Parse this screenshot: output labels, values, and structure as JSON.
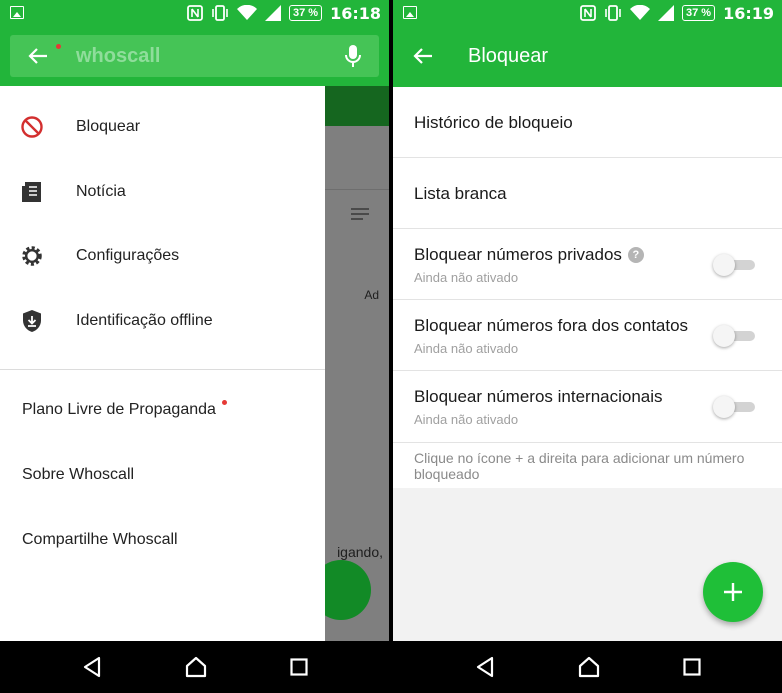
{
  "status_left": {
    "battery": "37 %",
    "time": "16:18"
  },
  "status_right": {
    "battery": "37 %",
    "time": "16:19"
  },
  "search": {
    "placeholder": "whoscall"
  },
  "drawer": {
    "icon_items": [
      {
        "label": "Bloquear",
        "icon": "block-icon"
      },
      {
        "label": "Notícia",
        "icon": "news-icon"
      },
      {
        "label": "Configurações",
        "icon": "gear-icon"
      },
      {
        "label": "Identificação offline",
        "icon": "shield-download-icon"
      }
    ],
    "text_items": [
      {
        "label": "Plano Livre de Propaganda",
        "badge": true
      },
      {
        "label": "Sobre Whoscall",
        "badge": false
      },
      {
        "label": "Compartilhe Whoscall",
        "badge": false
      }
    ]
  },
  "background": {
    "ad_label": "Ad",
    "partial_text": "igando,"
  },
  "block_screen": {
    "title": "Bloquear",
    "history": "Histórico de bloqueio",
    "whitelist": "Lista branca",
    "toggles": [
      {
        "label": "Bloquear números privados",
        "status": "Ainda não ativado",
        "on": false,
        "help": true
      },
      {
        "label": "Bloquear números fora dos contatos",
        "status": "Ainda não ativado",
        "on": false,
        "help": false
      },
      {
        "label": "Bloquear números internacionais",
        "status": "Ainda não ativado",
        "on": false,
        "help": false
      }
    ],
    "hint": "Clique no ícone + a direita para adicionar um número bloqueado",
    "help_glyph": "?"
  },
  "colors": {
    "primary": "#22b53a",
    "accent_red": "#e53935",
    "fab": "#1fbf38"
  }
}
